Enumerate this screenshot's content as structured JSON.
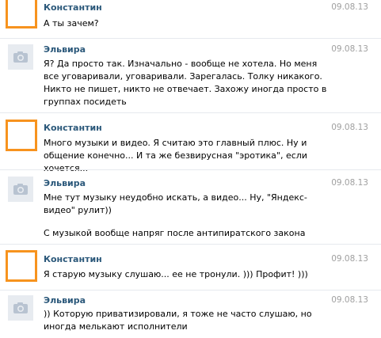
{
  "messages": [
    {
      "author": "Константин",
      "date": "09.08.13",
      "avatar": "orange",
      "texts": [
        "А ты зачем?"
      ]
    },
    {
      "author": "Эльвира",
      "date": "09.08.13",
      "avatar": "camera",
      "texts": [
        "Я? Да просто так. Изначально - вообще не хотела. Но меня все уговаривали, уговаривали. Зарегалась. Толку никакого. Никто не пишет, никто не отвечает. Захожу иногда просто в группах посидеть"
      ]
    },
    {
      "author": "Константин",
      "date": "09.08.13",
      "avatar": "orange",
      "texts": [
        "Много музыки и видео. Я считаю это главный плюс. Ну и общение конечно... И та же безвирусная \"эротика\", если хочется..."
      ]
    },
    {
      "author": "Эльвира",
      "date": "09.08.13",
      "avatar": "camera",
      "texts": [
        "Мне тут музыку неудобно искать, а видео... Ну, \"Яндекс-видео\" рулит))",
        "С музыкой вообще напряг после антипиратского закона"
      ]
    },
    {
      "author": "Константин",
      "date": "09.08.13",
      "avatar": "orange",
      "texts": [
        "Я старую музыку слушаю... ее не тронули. ))) Профит! )))"
      ]
    },
    {
      "author": "Эльвира",
      "date": "09.08.13",
      "avatar": "camera",
      "texts": [
        ")) Которую приватизировали, я тоже не часто слушаю, но иногда мелькают исполнители"
      ]
    }
  ]
}
